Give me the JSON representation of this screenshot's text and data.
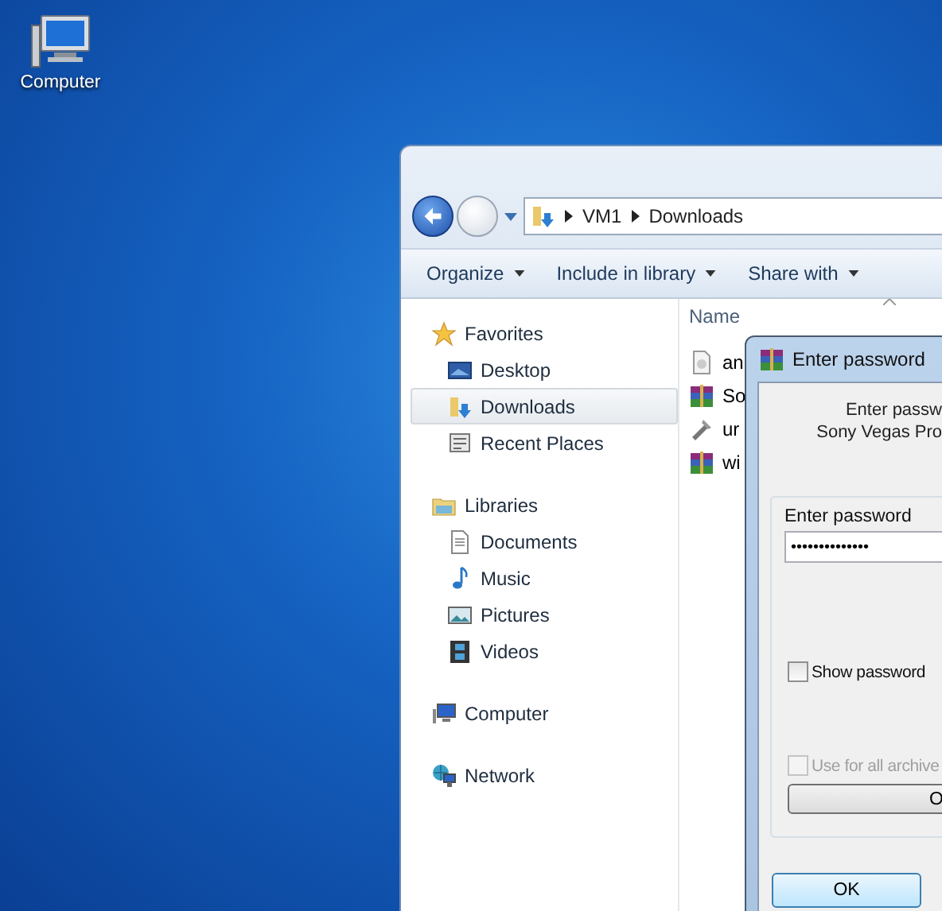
{
  "desktop_icons": [
    {
      "label": "Computer"
    }
  ],
  "explorer": {
    "breadcrumb": [
      "VM1",
      "Downloads"
    ],
    "toolbar": [
      {
        "label": "Organize"
      },
      {
        "label": "Include in library"
      },
      {
        "label": "Share with"
      }
    ],
    "column_header": "Name",
    "nav": [
      {
        "label": "Favorites",
        "kind": "star",
        "selected": false,
        "children": [
          {
            "label": "Desktop",
            "kind": "desktop",
            "selected": false
          },
          {
            "label": "Downloads",
            "kind": "downloads",
            "selected": true
          },
          {
            "label": "Recent Places",
            "kind": "recent",
            "selected": false
          }
        ]
      },
      {
        "label": "Libraries",
        "kind": "libraries",
        "selected": false,
        "children": [
          {
            "label": "Documents",
            "kind": "documents",
            "selected": false
          },
          {
            "label": "Music",
            "kind": "music",
            "selected": false
          },
          {
            "label": "Pictures",
            "kind": "pictures",
            "selected": false
          },
          {
            "label": "Videos",
            "kind": "videos",
            "selected": false
          }
        ]
      },
      {
        "label": "Computer",
        "kind": "computer",
        "selected": false
      },
      {
        "label": "Network",
        "kind": "network",
        "selected": false
      }
    ],
    "files": [
      {
        "name": "an",
        "kind": "generic"
      },
      {
        "name": "So",
        "kind": "archive"
      },
      {
        "name": "ur",
        "kind": "tool"
      },
      {
        "name": "wi",
        "kind": "archive"
      }
    ]
  },
  "dialog": {
    "title": "Enter password",
    "message": [
      "Enter passw",
      "Sony Vegas Pro"
    ],
    "group_label": "Enter password",
    "password": "••••••••••••••",
    "show_password": {
      "label": "Show password",
      "checked": false,
      "disabled": false
    },
    "use_for_all": {
      "label": "Use for all archive",
      "checked": false,
      "disabled": true
    },
    "side_button": "O",
    "ok_button": "OK"
  }
}
